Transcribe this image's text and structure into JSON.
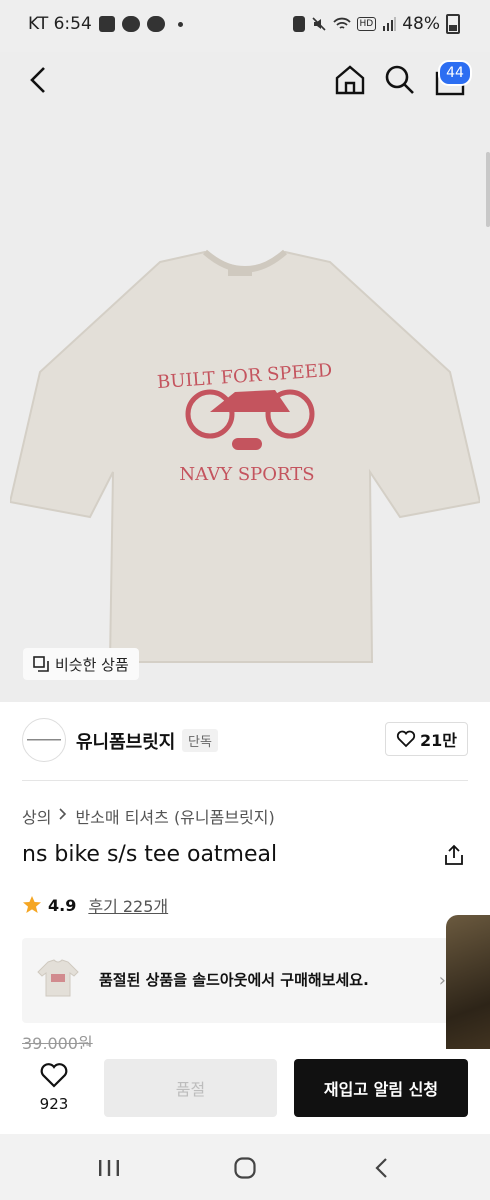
{
  "status_bar": {
    "carrier_time": "KT 6:54",
    "battery": "48%"
  },
  "header": {
    "cart_count": "44"
  },
  "hero": {
    "similar_label": "비슷한 상품"
  },
  "brand": {
    "name": "유니폼브릿지",
    "tag": "단독",
    "likes": "21만"
  },
  "breadcrumb": {
    "category": "상의",
    "subcategory": "반소매 티셔츠 (유니폼브릿지)"
  },
  "product": {
    "title": "ns bike s/s tee oatmeal",
    "rating": "4.9",
    "reviews": "후기 225개",
    "price": "39,000원"
  },
  "soldout_banner": {
    "text": "품절된 상품을 솔드아웃에서 구매해보세요."
  },
  "bottom": {
    "like_count": "923",
    "soldout_label": "품절",
    "restock_label": "재입고 알림 신청"
  },
  "colors": {
    "accent": "#2c6ef2",
    "star": "#f5a623",
    "shirt": "#e3dfd8",
    "print": "#c4545e"
  }
}
